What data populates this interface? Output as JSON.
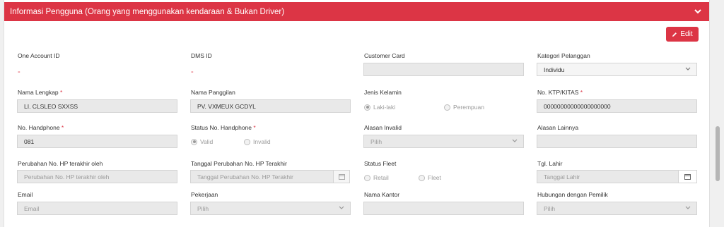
{
  "header": {
    "title": "Informasi Pengguna (Orang yang menggunakan kendaraan & Bukan Driver)"
  },
  "edit_button": {
    "label": "Edit"
  },
  "row1": {
    "one_account_id": {
      "label": "One Account ID",
      "value": "-"
    },
    "dms_id": {
      "label": "DMS ID",
      "value": "-"
    },
    "customer_card": {
      "label": "Customer Card",
      "value": ""
    },
    "kategori": {
      "label": "Kategori Pelanggan",
      "value": "Individu"
    }
  },
  "row2": {
    "nama_lengkap": {
      "label": "Nama Lengkap",
      "value": "LI. CLSLEO SXXSS"
    },
    "nama_panggilan": {
      "label": "Nama Panggilan",
      "value": "PV. VXMEUX GCDYL"
    },
    "jenis_kelamin": {
      "label": "Jenis Kelamin",
      "options": [
        "Laki-laki",
        "Perempuan"
      ],
      "selected": "Laki-laki"
    },
    "ktp": {
      "label": "No. KTP/KITAS",
      "value": "00000000000000000000"
    }
  },
  "row3": {
    "handphone": {
      "label": "No. Handphone",
      "value": "081"
    },
    "status_hp": {
      "label": "Status No. Handphone",
      "options": [
        "Valid",
        "Invalid"
      ],
      "selected": "Valid"
    },
    "alasan_invalid": {
      "label": "Alasan Invalid",
      "value": "Pilih"
    },
    "alasan_lainnya": {
      "label": "Alasan Lainnya",
      "value": ""
    }
  },
  "row4": {
    "perubahan_oleh": {
      "label": "Perubahan No. HP terakhir oleh",
      "placeholder": "Perubahan No. HP terakhir oleh"
    },
    "tanggal_perubahan": {
      "label": "Tanggal Perubahan No. HP Terakhir",
      "placeholder": "Tanggal Perubahan No. HP Terakhir"
    },
    "status_fleet": {
      "label": "Status Fleet",
      "options": [
        "Retail",
        "Fleet"
      ]
    },
    "tgl_lahir": {
      "label": "Tgl. Lahir",
      "placeholder": "Tanggal Lahir"
    }
  },
  "row5": {
    "email": {
      "label": "Email",
      "placeholder": "Email"
    },
    "pekerjaan": {
      "label": "Pekerjaan",
      "value": "Pilih"
    },
    "nama_kantor": {
      "label": "Nama Kantor",
      "value": ""
    },
    "hubungan": {
      "label": "Hubungan dengan Pemilik",
      "value": "Pilih"
    }
  },
  "colors": {
    "accent": "#dc3545",
    "field_bg": "#e9e9e9"
  },
  "icons": {
    "collapse": "chevron-down-icon",
    "edit": "pencil-icon",
    "calendar": "calendar-icon",
    "select": "chevron-down-icon"
  }
}
